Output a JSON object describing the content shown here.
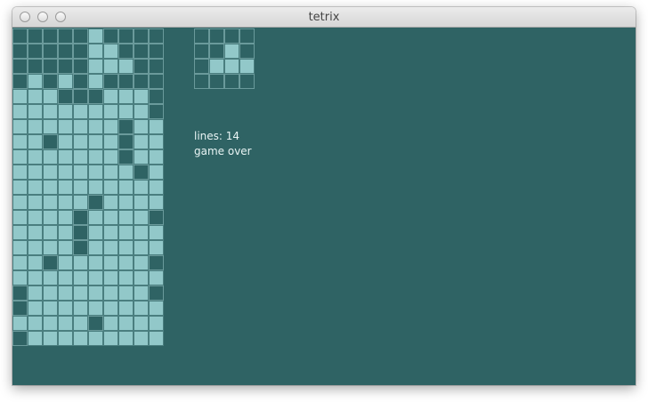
{
  "window": {
    "title": "tetrix"
  },
  "colors": {
    "background": "#2f6364",
    "filled_cell": "#92c8c9",
    "empty_cell_border": "#6a9a9b",
    "text": "#e8f4f4"
  },
  "board": {
    "rows": [
      "0000010000",
      "0000011000",
      "0000011100",
      "0101010000",
      "1110001110",
      "1111111110",
      "1111111011",
      "1101111011",
      "1111111011",
      "1111111101",
      "1111111111",
      "1111101111",
      "1111011110",
      "1111011111",
      "1111011111",
      "1101111110",
      "1111111111",
      "0111111110",
      "0111111111",
      "1111101111",
      "0111111111"
    ]
  },
  "next_piece": {
    "rows": [
      "0000",
      "0010",
      "0111",
      "0000"
    ]
  },
  "status": {
    "lines_text": "lines: 14",
    "state_text": "game over"
  }
}
